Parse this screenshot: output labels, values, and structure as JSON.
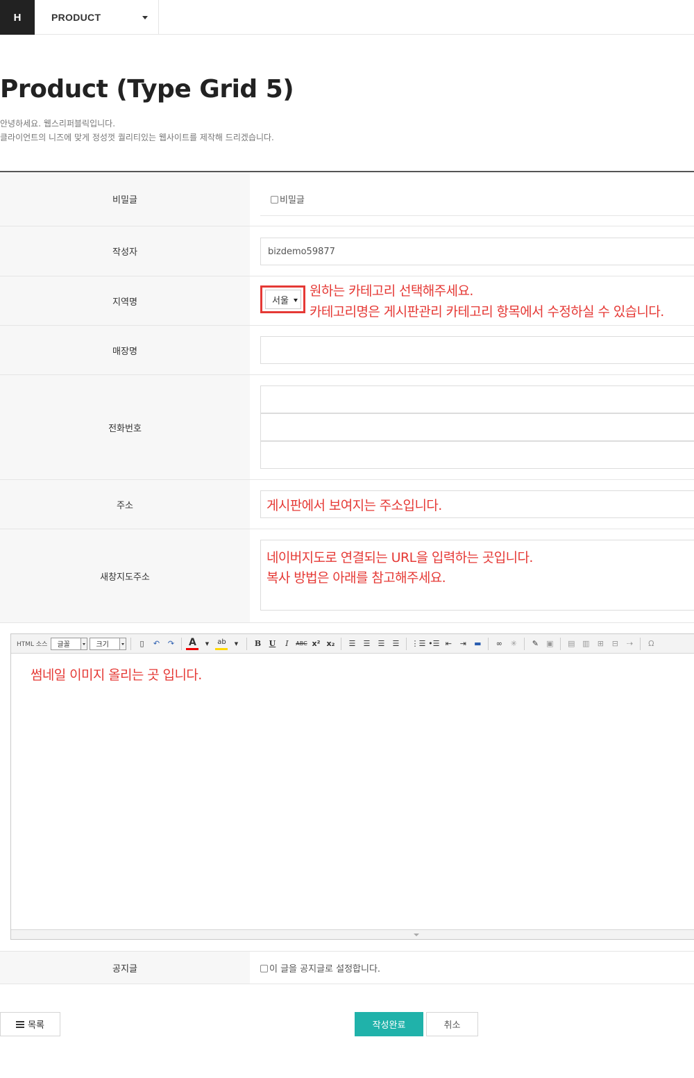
{
  "header": {
    "logo": "H",
    "menu_label": "PRODUCT"
  },
  "page": {
    "title": "Product (Type Grid 5)",
    "desc_line1": "안녕하세요. 웹스리퍼블릭입니다.",
    "desc_line2": "클라이언트의 니즈에 맞게 정성껏 퀄리티있는 웹사이트를 제작해 드리겠습니다."
  },
  "form": {
    "secret": {
      "label": "비밀글",
      "checkbox_label": "비밀글"
    },
    "author": {
      "label": "작성자",
      "value": "bizdemo59877"
    },
    "region": {
      "label": "지역명",
      "selected": "서울",
      "note_line1": "원하는 카테고리 선택해주세요.",
      "note_line2": "카테고리명은 게시판관리 카테고리 항목에서 수정하실 수 있습니다."
    },
    "store": {
      "label": "매장명",
      "value": ""
    },
    "phone": {
      "label": "전화번호"
    },
    "address": {
      "label": "주소",
      "value": "게시판에서 보여지는 주소입니다."
    },
    "map_url": {
      "label": "새창지도주소",
      "value_line1": "네이버지도로 연결되는 URL을 입력하는 곳입니다.",
      "value_line2": "복사 방법은 아래를 참고해주세요."
    },
    "notice": {
      "label": "공지글",
      "checkbox_label": "이 글을 공지글로 설정합니다."
    }
  },
  "editor": {
    "source_btn": "HTML 소스",
    "font_label": "글꼴",
    "size_label": "크기",
    "body_text": "썸네일 이미지 올리는 곳 입니다."
  },
  "buttons": {
    "list": "목록",
    "submit": "작성완료",
    "cancel": "취소"
  },
  "colors": {
    "accent": "#20b2aa",
    "annotation_red": "#e53935",
    "logo_bg": "#222222"
  }
}
